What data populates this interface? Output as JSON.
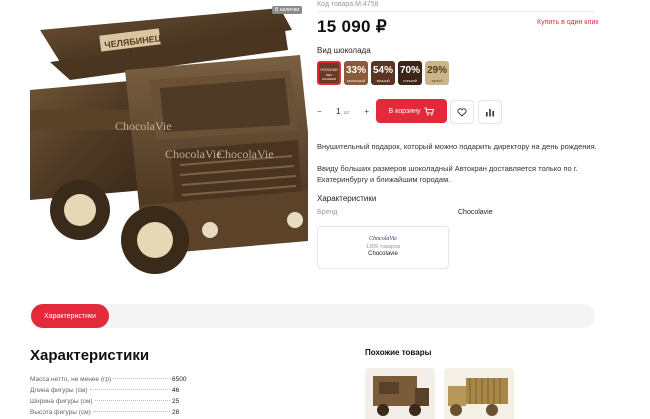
{
  "product": {
    "badge": "В наличии",
    "code": "Код товара:М.4758",
    "price": "15 090 ₽",
    "one_click": "Купить в один клик",
    "photo_text": {
      "crane_label": "ЧЕЛЯБИНЕЦ",
      "watermark": "ChocolaVie"
    }
  },
  "variants": {
    "title": "Вид шоколада",
    "items": [
      {
        "pct": "",
        "sub": "Без начинки",
        "label": "ПОЛОСКИ",
        "color": "#6b3a24"
      },
      {
        "pct": "33%",
        "sub": "молочный",
        "color": "#8a5a3a"
      },
      {
        "pct": "54%",
        "sub": "тёмный",
        "color": "#5a3522"
      },
      {
        "pct": "70%",
        "sub": "горький",
        "color": "#3d2418"
      },
      {
        "pct": "29%",
        "sub": "белый",
        "color": "#c9b58a"
      }
    ]
  },
  "buy": {
    "qty_minus": "−",
    "qty_value": "1",
    "qty_unit": "шт",
    "qty_plus": "+",
    "cart_label": "В корзину"
  },
  "description": {
    "p1": "Внушительный подарок, который можно подарить директору на день рождения.",
    "p2": "Ввиду больших размеров шоколадный Автокран доставляется только по г. Екатеринбургу и ближайшим городам."
  },
  "short_chars": {
    "title": "Характеристики",
    "brand_label": "Бренд",
    "brand_value": "Chocolavie"
  },
  "brand_card": {
    "logo": "ChocolaVie",
    "count": "1309 товаров",
    "name": "Chocolavie"
  },
  "tabs": {
    "active": "Характеристики"
  },
  "specs": {
    "title": "Характеристики",
    "rows": [
      {
        "label": "Масса нетто, не менее (гр)",
        "value": "6500"
      },
      {
        "label": "Длина фигуры (см)",
        "value": "46"
      },
      {
        "label": "Ширина фигуры (см)",
        "value": "25"
      },
      {
        "label": "Высота фигуры (см)",
        "value": "28"
      }
    ]
  },
  "similar": {
    "title": "Похожие товары"
  },
  "colors": {
    "accent": "#e22a3a"
  }
}
